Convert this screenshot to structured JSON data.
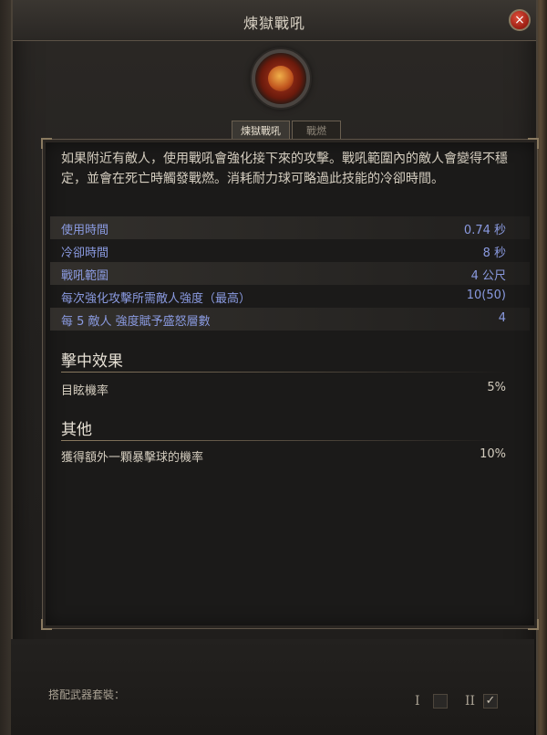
{
  "window": {
    "title": "煉獄戰吼",
    "close_icon": "×"
  },
  "skill": {
    "icon": "fiery-shield-icon"
  },
  "tabs": [
    {
      "label": "煉獄戰吼",
      "active": true
    },
    {
      "label": "戰燃",
      "active": false
    }
  ],
  "description": "如果附近有敵人，使用戰吼會強化接下來的攻擊。戰吼範圍內的敵人會變得不穩定，並會在死亡時觸發戰燃。消耗耐力球可略過此技能的冷卻時間。",
  "stats": [
    {
      "label": "使用時間",
      "value": "0.74 秒"
    },
    {
      "label": "冷卻時間",
      "value": "8 秒"
    },
    {
      "label": "戰吼範圍",
      "value": "4 公尺"
    },
    {
      "label": "每次強化攻擊所需敵人強度（最高）",
      "value": "10(50)"
    },
    {
      "label": "每 5 敵人 強度賦予盛怒層數",
      "value": "4"
    }
  ],
  "on_hit": {
    "title": "擊中效果",
    "rows": [
      {
        "label": "目眩機率",
        "value": "5%"
      }
    ]
  },
  "other": {
    "title": "其他",
    "rows": [
      {
        "label": "獲得額外一顆暴擊球的機率",
        "value": "10%"
      }
    ]
  },
  "footer": {
    "weapon_set_label": "搭配武器套裝：",
    "set_one": "I",
    "set_two": "II",
    "checkmark": "✓"
  },
  "colors": {
    "stat_text": "#8a9ae0",
    "close_button": "#c0301e"
  }
}
